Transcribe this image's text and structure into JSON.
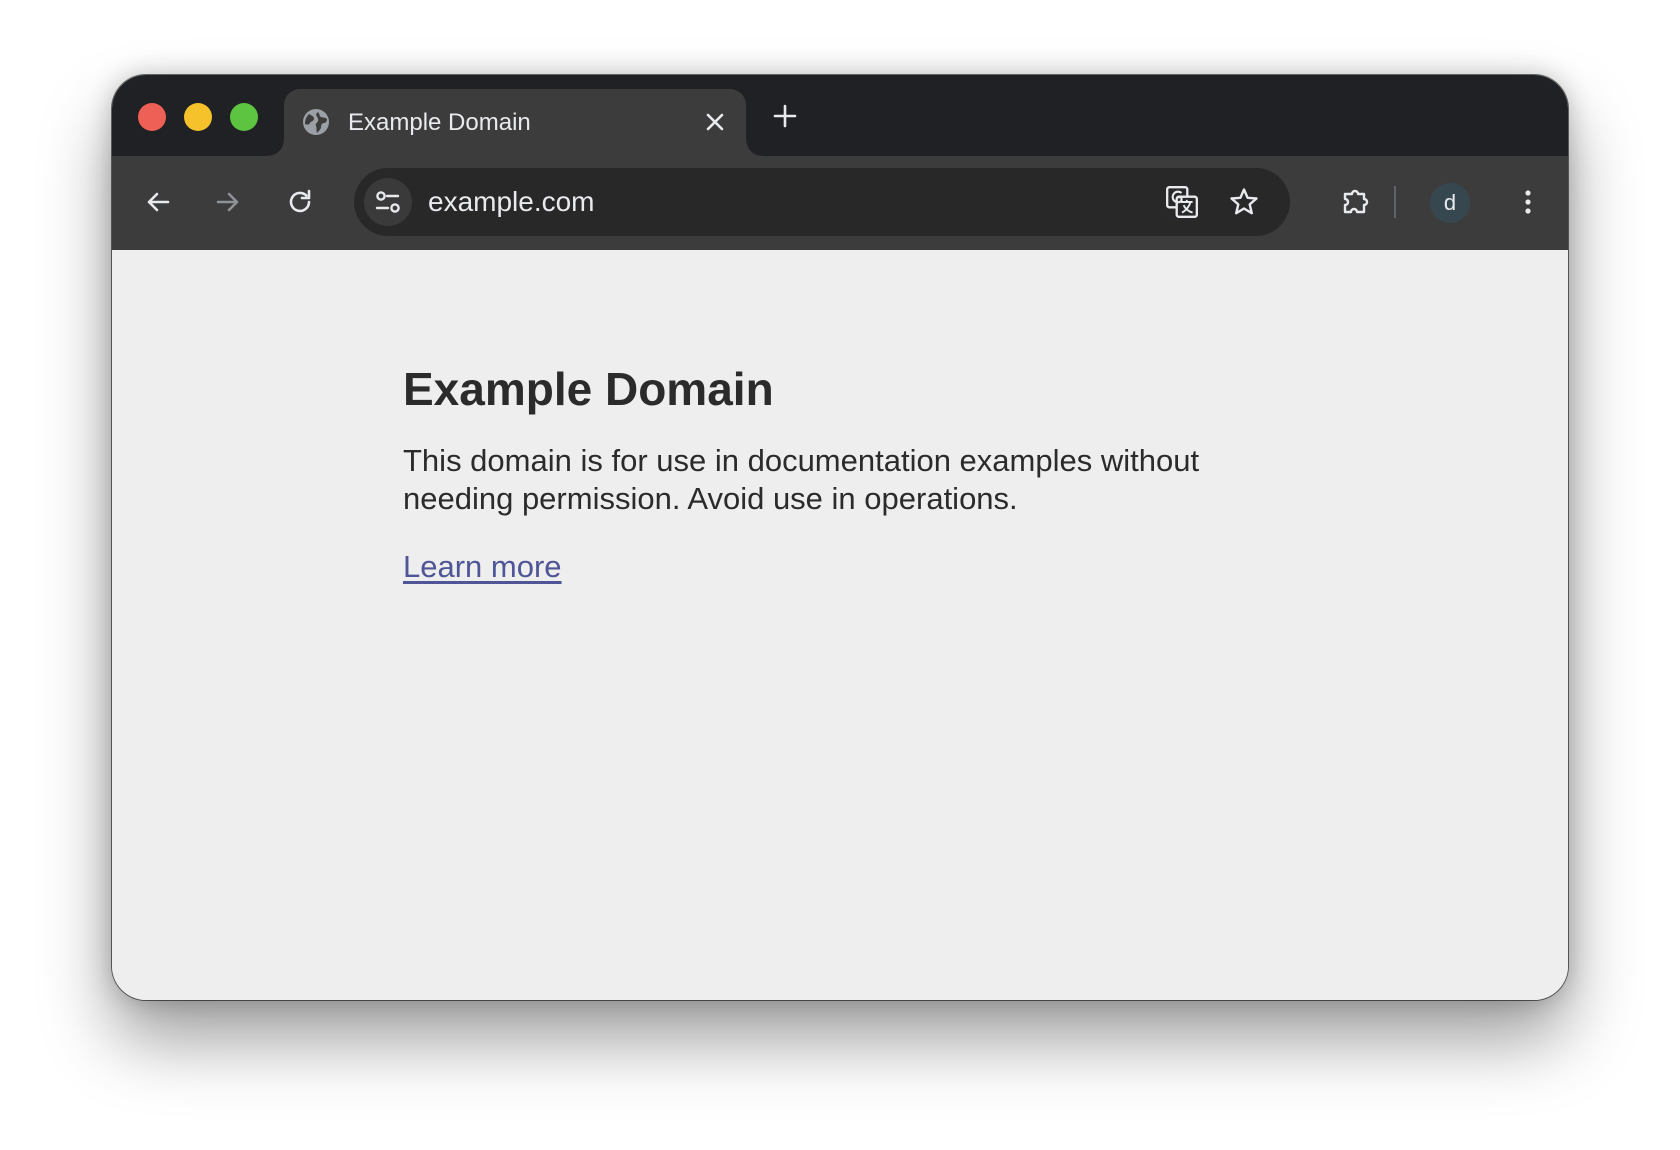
{
  "window": {
    "traffic_lights": [
      {
        "name": "close",
        "color": "#ee5f56"
      },
      {
        "name": "minimize",
        "color": "#f5c22b"
      },
      {
        "name": "zoom",
        "color": "#5cc441"
      }
    ]
  },
  "tab": {
    "title": "Example Domain",
    "favicon": "globe-icon",
    "close_icon": "close-icon"
  },
  "new_tab_icon": "plus-icon",
  "toolbar": {
    "back_icon": "arrow-left-icon",
    "forward_icon": "arrow-right-icon",
    "reload_icon": "reload-icon",
    "site_info_icon": "tune-icon",
    "url": "example.com",
    "translate_icon": "translate-icon",
    "bookmark_icon": "star-icon",
    "extensions_icon": "puzzle-icon",
    "profile_initial": "d",
    "menu_icon": "kebab-menu-icon"
  },
  "page": {
    "heading": "Example Domain",
    "paragraph": "This domain is for use in documentation examples without needing permission. Avoid use in operations.",
    "link": "Learn more"
  },
  "colors": {
    "titlebar": "#202124",
    "toolbar": "#3c3c3c",
    "omnibox": "#282828",
    "page_background": "#eeeeee",
    "text": "#2b2b2b",
    "link": "#4f5596"
  }
}
